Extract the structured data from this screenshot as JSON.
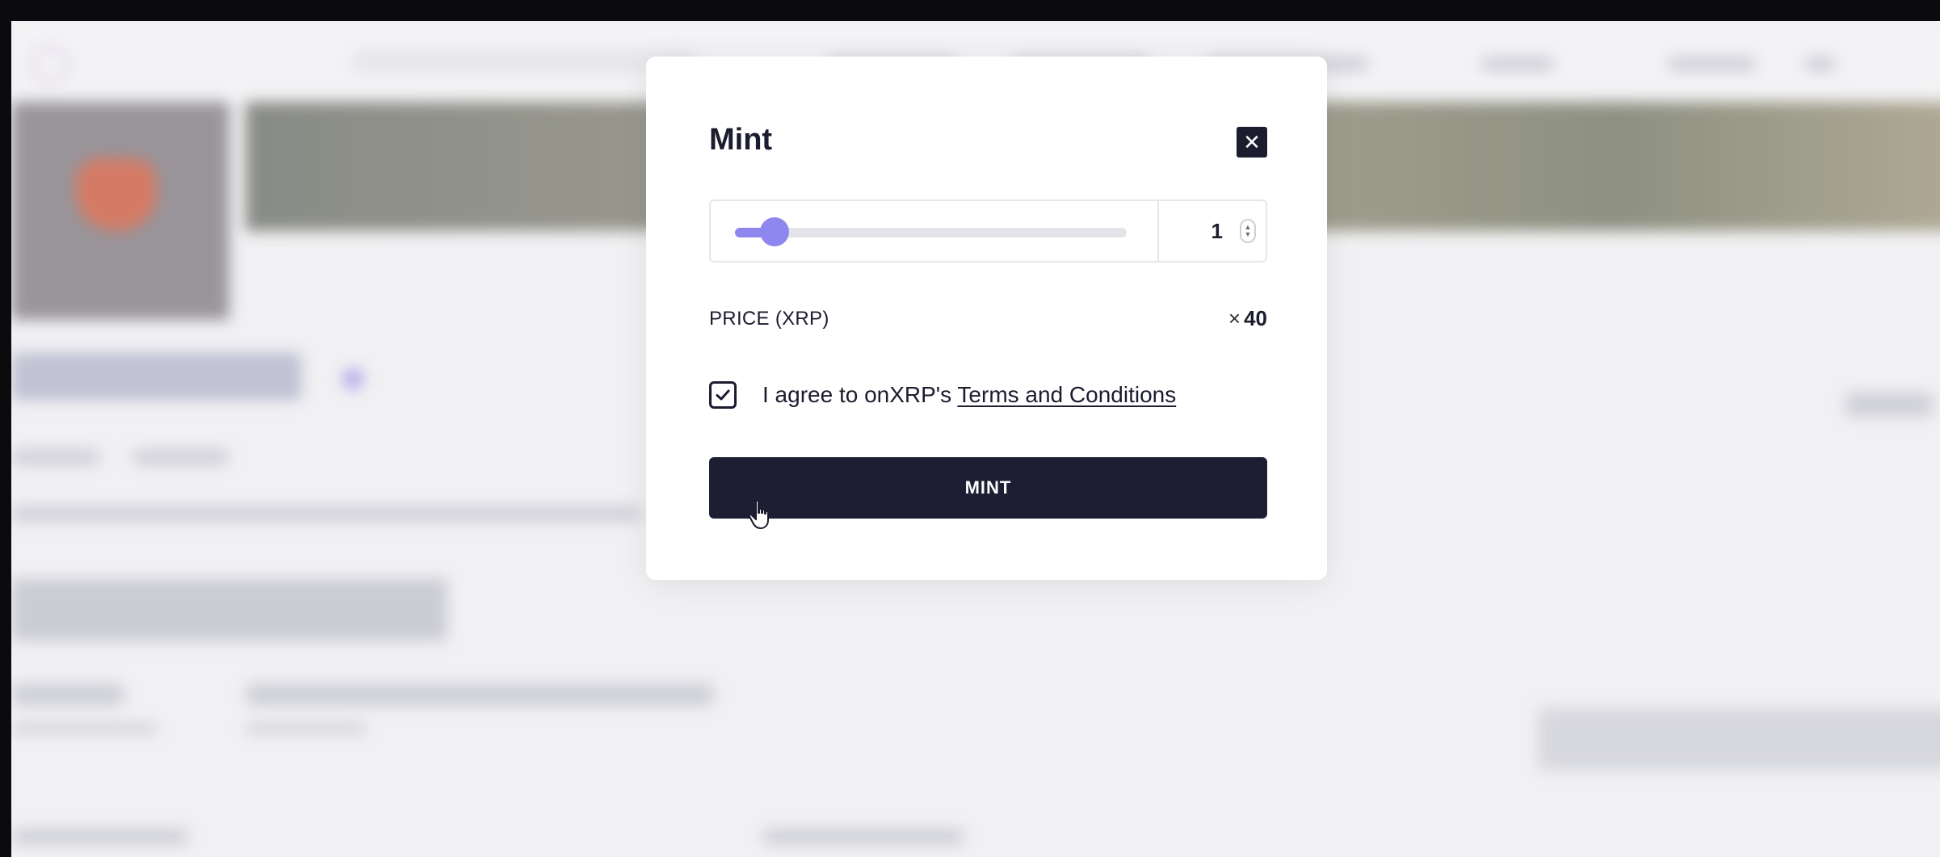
{
  "modal": {
    "title": "Mint",
    "close_icon": "close-icon",
    "quantity": {
      "value": "1",
      "slider_fraction": 0.05
    },
    "price": {
      "label": "PRICE (XRP)",
      "multiplier": "×",
      "value": "40"
    },
    "agree": {
      "checked": true,
      "text": "I agree to onXRP's ",
      "link": "Terms and Conditions"
    },
    "mint_button": "MINT"
  },
  "colors": {
    "dark": "#1d1e33",
    "accent": "#8f87f0",
    "overlay": "#f1f1f3"
  }
}
